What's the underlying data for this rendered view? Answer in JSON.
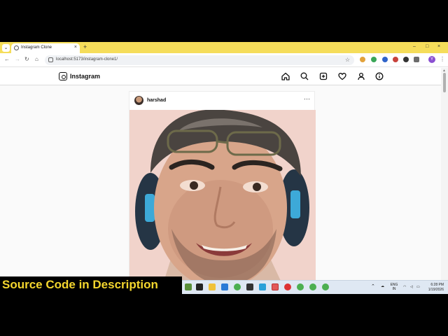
{
  "browser": {
    "tab_title": "Instagram Clone",
    "tab_close": "×",
    "new_tab": "+",
    "url": "localhost:5173/instagram-clone1/",
    "window_controls": [
      "–",
      "□",
      "×"
    ],
    "profile_initial": "Y",
    "menu_glyph": "⌄"
  },
  "header": {
    "brand": "Instagram",
    "nav_icons": [
      "home-icon",
      "search-icon",
      "create-post-icon",
      "heart-icon",
      "profile-icon",
      "info-icon"
    ]
  },
  "post": {
    "username": "harshad",
    "more": "···"
  },
  "taskbar": {
    "lang_top": "ENG",
    "lang_bottom": "IN",
    "time": "6:28 PM",
    "date": "1/19/2026"
  },
  "banner": {
    "text": "Source Code in  Description"
  },
  "colors": {
    "tabstrip": "#f5dd5a",
    "banner_text": "#f4d62e",
    "taskbar": "#dfe8f3"
  }
}
